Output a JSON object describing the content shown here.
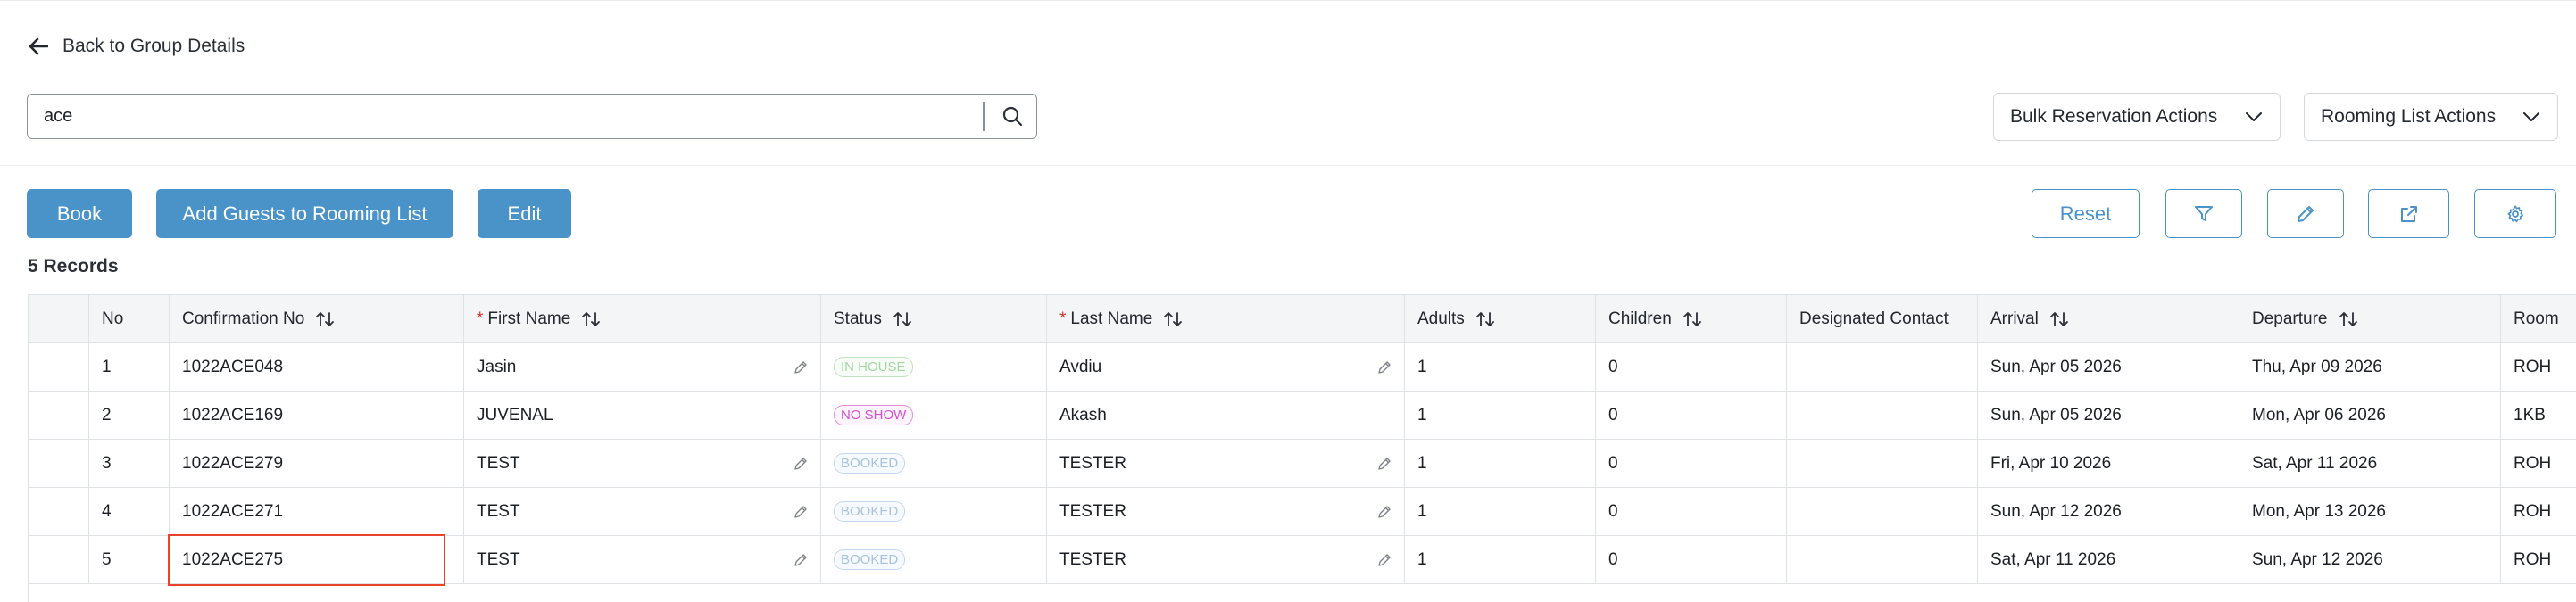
{
  "back_link": {
    "label": "Back to Group Details",
    "icon": "arrow-left-icon"
  },
  "search": {
    "value": "ace",
    "icon": "search-icon"
  },
  "dropdowns": {
    "bulk": "Bulk Reservation Actions",
    "rooming": "Rooming List Actions",
    "icon": "chevron-down-icon"
  },
  "toolbar": {
    "book": "Book",
    "add_guests": "Add Guests to Rooming List",
    "edit": "Edit",
    "reset": "Reset",
    "icons": [
      "filter-icon",
      "pencil-icon",
      "external-link-icon",
      "gear-icon"
    ]
  },
  "records_label": "5 Records",
  "table": {
    "columns": {
      "no": "No",
      "confirmation": "Confirmation No",
      "first_name": "First Name",
      "status": "Status",
      "last_name": "Last Name",
      "adults": "Adults",
      "children": "Children",
      "designated_contact": "Designated Contact",
      "arrival": "Arrival",
      "departure": "Departure",
      "room": "Room"
    },
    "required_marker": "*",
    "rows": [
      {
        "no": "1",
        "confirmation": "1022ACE048",
        "first_name": "Jasin",
        "status": "IN HOUSE",
        "last_name": "Avdiu",
        "adults": "1",
        "children": "0",
        "designated_contact": "",
        "arrival": "Sun, Apr 05 2026",
        "departure": "Thu, Apr 09 2026",
        "room": "ROH"
      },
      {
        "no": "2",
        "confirmation": "1022ACE169",
        "first_name": "JUVENAL",
        "status": "NO SHOW",
        "last_name": "Akash",
        "adults": "1",
        "children": "0",
        "designated_contact": "",
        "arrival": "Sun, Apr 05 2026",
        "departure": "Mon, Apr 06 2026",
        "room": "1KB"
      },
      {
        "no": "3",
        "confirmation": "1022ACE279",
        "first_name": "TEST",
        "status": "BOOKED",
        "last_name": "TESTER",
        "adults": "1",
        "children": "0",
        "designated_contact": "",
        "arrival": "Fri, Apr 10 2026",
        "departure": "Sat, Apr 11 2026",
        "room": "ROH"
      },
      {
        "no": "4",
        "confirmation": "1022ACE271",
        "first_name": "TEST",
        "status": "BOOKED",
        "last_name": "TESTER",
        "adults": "1",
        "children": "0",
        "designated_contact": "",
        "arrival": "Sun, Apr 12 2026",
        "departure": "Mon, Apr 13 2026",
        "room": "ROH"
      },
      {
        "no": "5",
        "confirmation": "1022ACE275",
        "first_name": "TEST",
        "status": "BOOKED",
        "last_name": "TESTER",
        "adults": "1",
        "children": "0",
        "designated_contact": "",
        "arrival": "Sat, Apr 11 2026",
        "departure": "Sun, Apr 12 2026",
        "room": "ROH"
      }
    ]
  },
  "colors": {
    "primary": "#4a93c9",
    "highlight": "#e8442d",
    "required": "#d62d2d",
    "in_house": "#a6d6a6",
    "no_show": "#d64fd0",
    "booked": "#a9c3de"
  }
}
